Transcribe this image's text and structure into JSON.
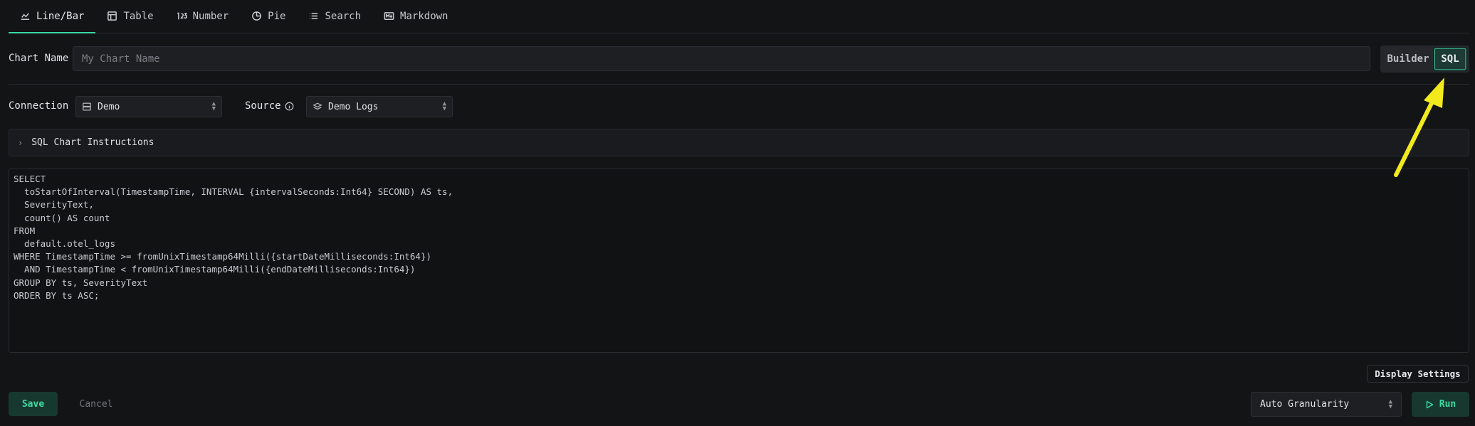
{
  "tabs": [
    {
      "label": "Line/Bar",
      "icon": "line-chart-icon"
    },
    {
      "label": "Table",
      "icon": "table-icon"
    },
    {
      "label": "Number",
      "icon": "number-icon"
    },
    {
      "label": "Pie",
      "icon": "pie-icon"
    },
    {
      "label": "Search",
      "icon": "list-icon"
    },
    {
      "label": "Markdown",
      "icon": "markdown-icon"
    }
  ],
  "chart_name": {
    "label": "Chart Name",
    "placeholder": "My Chart Name"
  },
  "mode_toggle": {
    "builder": "Builder",
    "sql": "SQL",
    "active": "SQL"
  },
  "connection": {
    "label": "Connection",
    "value": "Demo"
  },
  "source": {
    "label": "Source",
    "value": "Demo Logs"
  },
  "instructions": {
    "label": "SQL Chart Instructions"
  },
  "sql": "SELECT\n  toStartOfInterval(TimestampTime, INTERVAL {intervalSeconds:Int64} SECOND) AS ts,\n  SeverityText,\n  count() AS count\nFROM\n  default.otel_logs\nWHERE TimestampTime >= fromUnixTimestamp64Milli({startDateMilliseconds:Int64})\n  AND TimestampTime < fromUnixTimestamp64Milli({endDateMilliseconds:Int64})\nGROUP BY ts, SeverityText\nORDER BY ts ASC;",
  "display_settings": "Display Settings",
  "save": "Save",
  "cancel": "Cancel",
  "granularity": "Auto Granularity",
  "run": "Run",
  "colors": {
    "accent": "#39d8a2",
    "annotation_arrow": "#f2ea1c"
  }
}
